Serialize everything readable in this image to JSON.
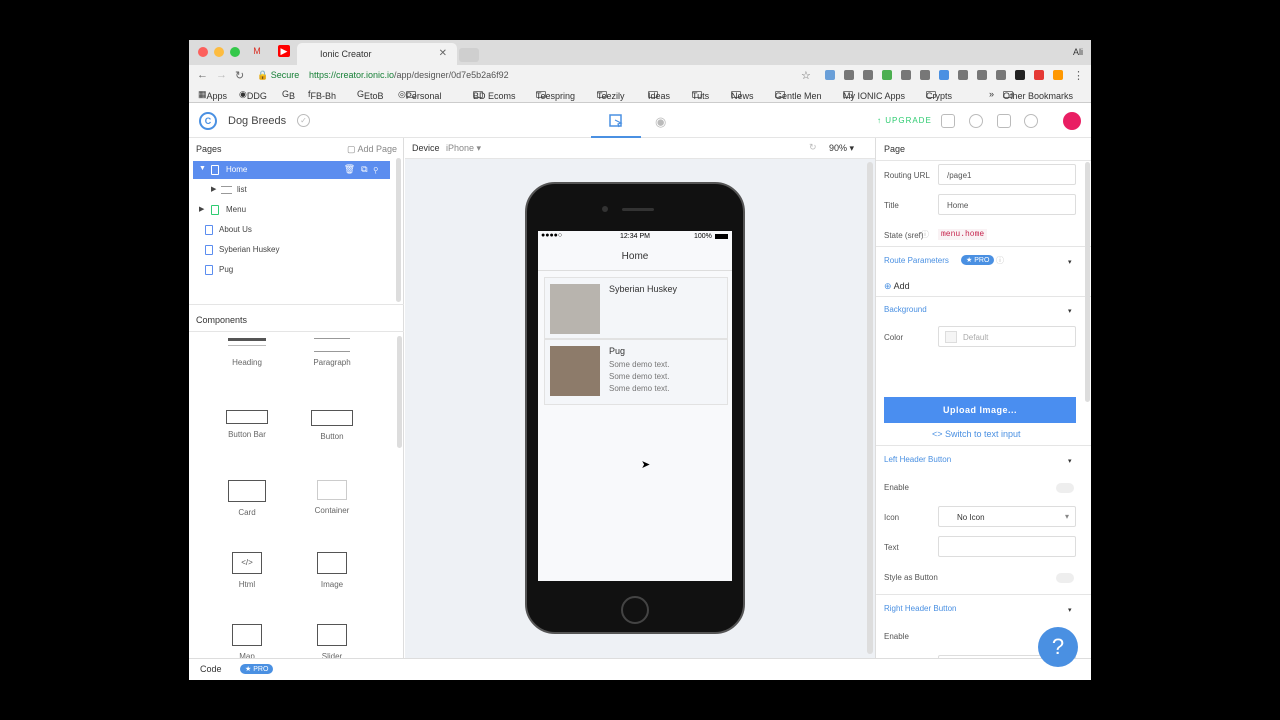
{
  "browser": {
    "tab_title": "Ionic Creator",
    "user": "Ali",
    "secure_label": "Secure",
    "url_host": "https://creator.ionic.io",
    "url_path": "/app/designer/0d7e5b2a6f92",
    "bookmarks": [
      "Apps",
      "DDG",
      "B",
      "FB-Bh",
      "EtoB",
      "Personal",
      "BD Ecoms",
      "Teespring",
      "Teezily",
      "Ideas",
      "Tuts",
      "News",
      "Gentle Men",
      "My IONIC Apps",
      "Crypts",
      "»",
      "Other Bookmarks"
    ]
  },
  "app": {
    "name": "Dog Breeds",
    "upgrade": "UPGRADE"
  },
  "pages_panel": {
    "title": "Pages",
    "add_page": "Add Page",
    "items": [
      "Home",
      "list",
      "Menu",
      "About Us",
      "Syberian Huskey",
      "Pug"
    ]
  },
  "components_panel": {
    "title": "Components",
    "items": [
      "Heading",
      "Paragraph",
      "Button Bar",
      "Button",
      "Card",
      "Container",
      "Html",
      "Image",
      "Map",
      "Slider"
    ]
  },
  "canvas": {
    "device_label": "Device",
    "device": "iPhone",
    "zoom": "90%"
  },
  "phone": {
    "time": "12:34 PM",
    "battery": "100%",
    "nav_title": "Home",
    "cards": [
      {
        "title": "Syberian Huskey",
        "lines": []
      },
      {
        "title": "Pug",
        "lines": [
          "Some demo text.",
          "Some demo text.",
          "Some demo text."
        ]
      }
    ]
  },
  "right_panel": {
    "title": "Page",
    "routing_url_label": "Routing URL",
    "routing_url": "/page1",
    "title_label": "Title",
    "title_value": "Home",
    "state_label": "State (sref)",
    "state_value": "menu.home",
    "route_params": "Route Parameters",
    "pro": "★ PRO",
    "add": "Add",
    "background": "Background",
    "color_label": "Color",
    "color_value": "Default",
    "upload": "Upload Image...",
    "switch_text": "Switch to text input",
    "left_header": "Left Header Button",
    "enable": "Enable",
    "icon": "Icon",
    "no_icon": "No Icon",
    "text": "Text",
    "style_as_button": "Style as Button",
    "right_header": "Right Header Button"
  },
  "bottom": {
    "code": "Code",
    "pro": "★ PRO"
  },
  "help": "?"
}
